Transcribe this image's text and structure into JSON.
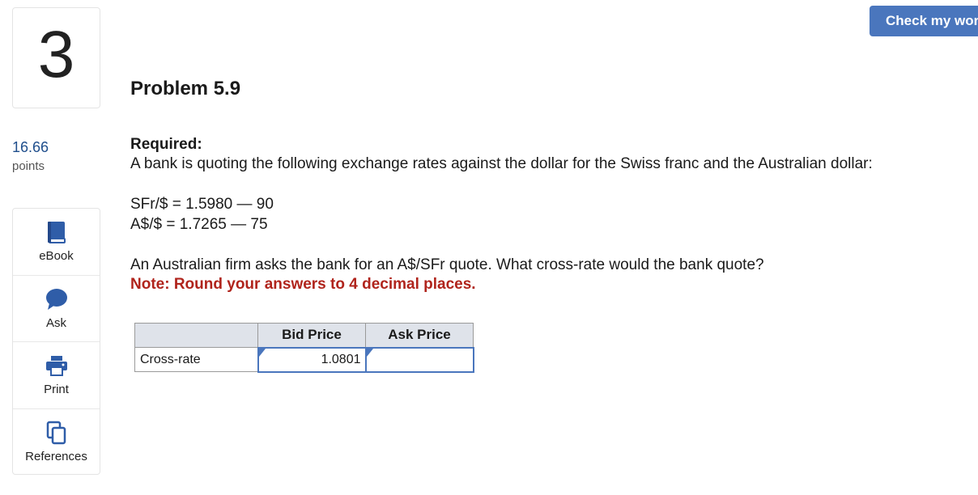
{
  "question": {
    "number": "3",
    "points_value": "16.66",
    "points_label": "points"
  },
  "tools": [
    {
      "label": "eBook",
      "icon": "book-icon"
    },
    {
      "label": "Ask",
      "icon": "speech-bubble-icon"
    },
    {
      "label": "Print",
      "icon": "printer-icon"
    },
    {
      "label": "References",
      "icon": "documents-icon"
    }
  ],
  "header": {
    "check_button_label": "Check my work"
  },
  "problem": {
    "title": "Problem 5.9",
    "required_label": "Required:",
    "prompt": "A bank is quoting the following exchange rates against the dollar for the Swiss franc and the Australian dollar:",
    "rate_sfr": "SFr/$ = 1.5980 — 90",
    "rate_aud": "A$/$ = 1.7265 — 75",
    "question_text": "An Australian firm asks the bank for an A$/SFr quote. What cross-rate would the bank quote?",
    "note": "Note: Round your answers to 4 decimal places."
  },
  "answer_table": {
    "headers": [
      "",
      "Bid Price",
      "Ask Price"
    ],
    "rows": [
      {
        "label": "Cross-rate",
        "bid_value": "1.0801",
        "ask_value": ""
      }
    ]
  },
  "colors": {
    "accent_blue": "#4a76bd",
    "note_red": "#b0241c",
    "points_blue": "#1f4e8c",
    "table_header_bg": "#dfe3ea"
  }
}
